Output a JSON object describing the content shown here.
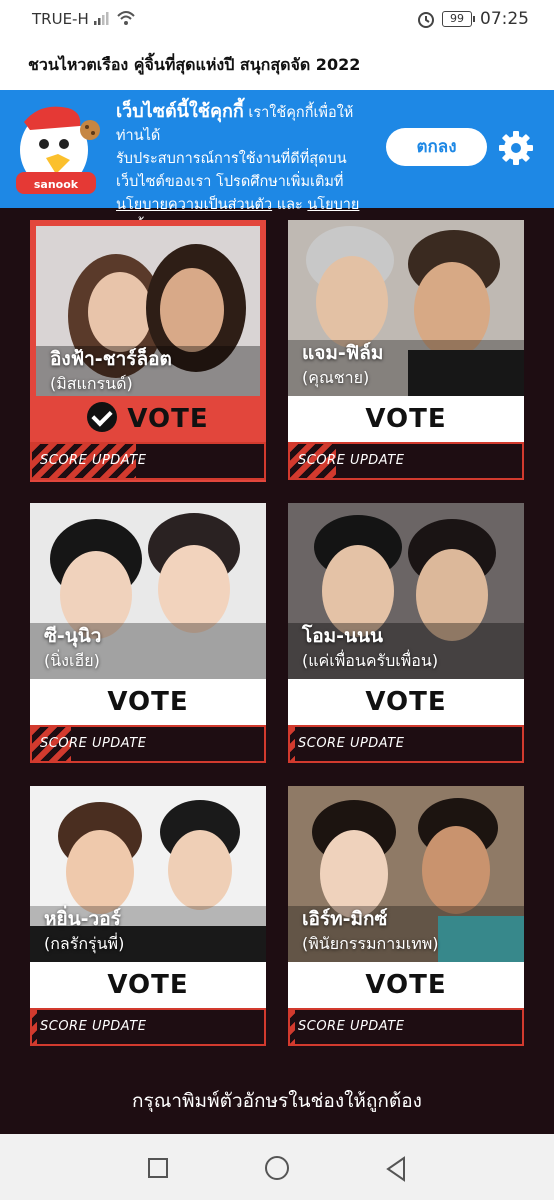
{
  "status": {
    "carrier": "TRUE-H",
    "battery": "99",
    "time": "07:25"
  },
  "page": {
    "title": "ชวนไหวตเรือง คู่จิ้นที่สุดแห่งปี สนุกสุดจัด 2022"
  },
  "cookie": {
    "lead": "เว็บไซต์นี้ใช้คุกกี้",
    "text1": " เราใช้คุกกี้เพื่อให้ท่านได้",
    "text2": "รับประสบการณ์การใช้งานที่ดีที่สุดบน",
    "text3": "เว็บไซต์ของเรา โปรดศึกษาเพิ่มเติมที่",
    "privacy_link": "นโยบายความเป็นส่วนตัว",
    "and": " และ ",
    "cookie_link": "นโยบายคุกกี้",
    "ok_label": "ตกลง",
    "mascot_label": "sanook"
  },
  "vote_label": "VOTE",
  "score_label": "SCORE UPDATE",
  "candidates": [
    {
      "name": "อิงฟ้า-ชาร์ล็อต",
      "show": "(มิสแกรนด์)",
      "selected": true,
      "score_fraction": 0.45
    },
    {
      "name": "แจม-ฟิล์ม",
      "show": "(คุณชาย)",
      "selected": false,
      "score_fraction": 0.2
    },
    {
      "name": "ซี-นุนิว",
      "show": "(นิ่งเฮีย)",
      "selected": false,
      "score_fraction": 0.17
    },
    {
      "name": "โอม-นนน",
      "show": "(แค่เพื่อนครับเพื่อน)",
      "selected": false,
      "score_fraction": 0.02
    },
    {
      "name": "หยิ่น-วอร์",
      "show": "(กลรักรุ่นพี่)",
      "selected": false,
      "score_fraction": 0.02
    },
    {
      "name": "เอิร์ท-มิกซ์",
      "show": "(พินัยกรรมกามเทพ)",
      "selected": false,
      "score_fraction": 0.02
    }
  ],
  "footer": {
    "captcha_prompt": "กรุณาพิมพ์ตัวอักษรในช่องให้ถูกต้อง"
  },
  "colors": {
    "accent": "#e2463c",
    "banner": "#1e88e5",
    "background": "#1e0d12"
  }
}
